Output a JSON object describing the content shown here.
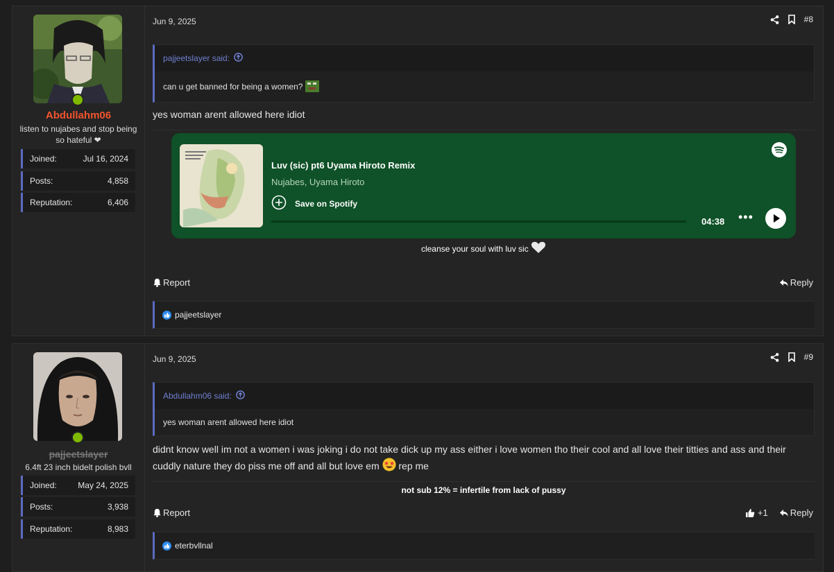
{
  "posts": [
    {
      "user": {
        "username": "Abdullahm06",
        "title": "listen to nujabes and stop being so hateful ❤",
        "stats": [
          {
            "label": "Joined:",
            "value": "Jul 16, 2024"
          },
          {
            "label": "Posts:",
            "value": "4,858"
          },
          {
            "label": "Reputation:",
            "value": "6,406"
          }
        ]
      },
      "date": "Jun 9, 2025",
      "number": "#8",
      "quote": {
        "author": "pajjeetslayer said:",
        "text": "can u get banned for being a women?"
      },
      "message": "yes woman arent allowed here idiot",
      "embed": {
        "track": "Luv (sic) pt6 Uyama Hiroto Remix",
        "artist": "Nujabes, Uyama Hiroto",
        "save": "Save on Spotify",
        "duration": "04:38"
      },
      "signature": "cleanse your soul with luv sic",
      "report": "Report",
      "reply": "Reply",
      "reaction_user": "pajjeetslayer"
    },
    {
      "user": {
        "username": "pajjeetslayer",
        "title": "6.4ft 23 inch bidelt polish bvll",
        "stats": [
          {
            "label": "Joined:",
            "value": "May 24, 2025"
          },
          {
            "label": "Posts:",
            "value": "3,938"
          },
          {
            "label": "Reputation:",
            "value": "8,983"
          }
        ]
      },
      "date": "Jun 9, 2025",
      "number": "#9",
      "quote": {
        "author": "Abdullahm06 said:",
        "text": "yes woman arent allowed here idiot"
      },
      "message": "didnt know well im not a women i was joking i do not take dick up my ass either i love women tho their cool and all love their titties and ass and their cuddly nature they do piss me off and all but love em",
      "message_tail": "rep me",
      "signature": "not sub 12% = infertile from lack of pussy",
      "report": "Report",
      "like_count": "+1",
      "reply": "Reply",
      "reaction_user": "eterbvllnal"
    }
  ],
  "colors": {
    "background": "#1e1e1e",
    "panel": "#242424",
    "accent": "#5c6bc0",
    "username1": "#f2542d",
    "online": "#7fba00",
    "spotify_bg": "#0f5128"
  },
  "icons": [
    "share-icon",
    "bookmark-icon",
    "arrow-up-circle-icon",
    "bell-icon",
    "reply-icon",
    "thumbs-up-icon",
    "spotify-icon",
    "add-circle-icon",
    "play-icon",
    "heart-icon",
    "star-eyes-emoji",
    "frog-emoji"
  ]
}
